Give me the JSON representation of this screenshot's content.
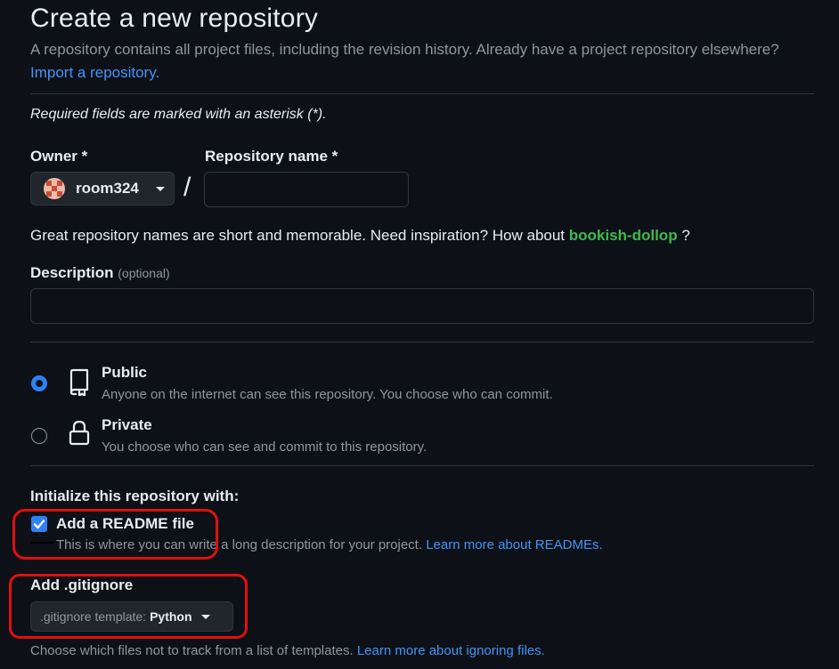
{
  "header": {
    "title": "Create a new repository",
    "subtitle": "A repository contains all project files, including the revision history. Already have a project repository elsewhere?",
    "import_link": "Import a repository."
  },
  "required_note": "Required fields are marked with an asterisk (*).",
  "owner": {
    "label": "Owner *",
    "value": "room324"
  },
  "separator": "/",
  "repo_name": {
    "label": "Repository name *",
    "value": "",
    "placeholder": ""
  },
  "hint": {
    "text": "Great repository names are short and memorable. Need inspiration? How about",
    "suggestion": "bookish-dollop",
    "suffix": "?"
  },
  "description": {
    "label": "Description",
    "optional": "(optional)",
    "value": ""
  },
  "visibility": {
    "selected": "public",
    "public": {
      "title": "Public",
      "desc": "Anyone on the internet can see this repository. You choose who can commit.",
      "icon": "repo-icon"
    },
    "private": {
      "title": "Private",
      "desc": "You choose who can see and commit to this repository.",
      "icon": "lock-icon"
    }
  },
  "initialize": {
    "heading": "Initialize this repository with:",
    "readme": {
      "label": "Add a README file",
      "checked": true,
      "desc": "This is where you can write a long description for your project.",
      "link": "Learn more about READMEs."
    }
  },
  "gitignore": {
    "label": "Add .gitignore",
    "template_label": ".gitignore template:",
    "template_value": "Python",
    "desc": "Choose which files not to track from a list of templates.",
    "link": "Learn more about ignoring files."
  },
  "colors": {
    "background": "#0d1117",
    "link": "#4493f8",
    "suggestion": "#3fb950",
    "accent": "#2f81f7",
    "annotation": "#e01010"
  }
}
